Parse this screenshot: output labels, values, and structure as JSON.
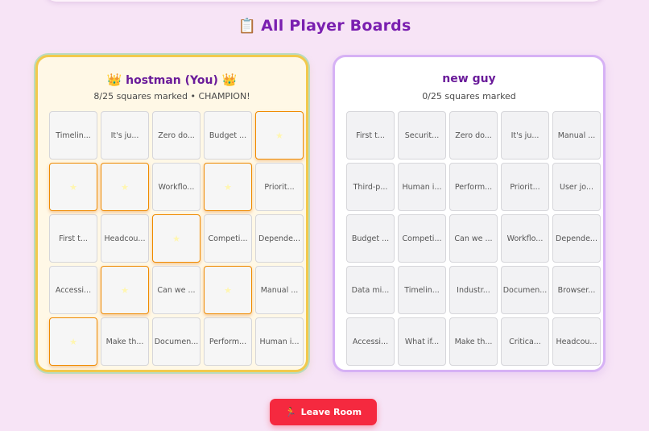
{
  "page": {
    "title_icon": "📋",
    "title": "All Player Boards",
    "leave_icon": "🏃",
    "leave_label": "Leave Room"
  },
  "colors": {
    "background": "#f7e4f6",
    "title": "#7a1fb0",
    "marked_square": "#ff9800",
    "leave_button": "#f5293f",
    "you_border": "#f2c94c",
    "other_border": "#d6b1f5"
  },
  "boards": [
    {
      "crown_icon": "👑",
      "name": "hostman (You)",
      "status": "8/25 squares marked • CHAMPION!",
      "cells": [
        {
          "text": "Timelin...",
          "marked": false
        },
        {
          "text": "It's ju...",
          "marked": false
        },
        {
          "text": "Zero do...",
          "marked": false
        },
        {
          "text": "Budget ...",
          "marked": false
        },
        {
          "text": "★",
          "marked": true
        },
        {
          "text": "★",
          "marked": true
        },
        {
          "text": "★",
          "marked": true
        },
        {
          "text": "Workflo...",
          "marked": false
        },
        {
          "text": "★",
          "marked": true
        },
        {
          "text": "Priorit...",
          "marked": false
        },
        {
          "text": "First t...",
          "marked": false
        },
        {
          "text": "Headcou...",
          "marked": false
        },
        {
          "text": "★",
          "marked": true
        },
        {
          "text": "Competi...",
          "marked": false
        },
        {
          "text": "Depende...",
          "marked": false
        },
        {
          "text": "Accessi...",
          "marked": false
        },
        {
          "text": "★",
          "marked": true
        },
        {
          "text": "Can we ...",
          "marked": false
        },
        {
          "text": "★",
          "marked": true
        },
        {
          "text": "Manual ...",
          "marked": false
        },
        {
          "text": "★",
          "marked": true
        },
        {
          "text": "Make th...",
          "marked": false
        },
        {
          "text": "Documen...",
          "marked": false
        },
        {
          "text": "Perform...",
          "marked": false
        },
        {
          "text": "Human i...",
          "marked": false
        }
      ]
    },
    {
      "crown_icon": "",
      "name": "new guy",
      "status": "0/25 squares marked",
      "cells": [
        {
          "text": "First t...",
          "marked": false
        },
        {
          "text": "Securit...",
          "marked": false
        },
        {
          "text": "Zero do...",
          "marked": false
        },
        {
          "text": "It's ju...",
          "marked": false
        },
        {
          "text": "Manual ...",
          "marked": false
        },
        {
          "text": "Third-p...",
          "marked": false
        },
        {
          "text": "Human i...",
          "marked": false
        },
        {
          "text": "Perform...",
          "marked": false
        },
        {
          "text": "Priorit...",
          "marked": false
        },
        {
          "text": "User jo...",
          "marked": false
        },
        {
          "text": "Budget ...",
          "marked": false
        },
        {
          "text": "Competi...",
          "marked": false
        },
        {
          "text": "Can we ...",
          "marked": false
        },
        {
          "text": "Workflo...",
          "marked": false
        },
        {
          "text": "Depende...",
          "marked": false
        },
        {
          "text": "Data mi...",
          "marked": false
        },
        {
          "text": "Timelin...",
          "marked": false
        },
        {
          "text": "Industr...",
          "marked": false
        },
        {
          "text": "Documen...",
          "marked": false
        },
        {
          "text": "Browser...",
          "marked": false
        },
        {
          "text": "Accessi...",
          "marked": false
        },
        {
          "text": "What if...",
          "marked": false
        },
        {
          "text": "Make th...",
          "marked": false
        },
        {
          "text": "Critica...",
          "marked": false
        },
        {
          "text": "Headcou...",
          "marked": false
        }
      ]
    }
  ]
}
